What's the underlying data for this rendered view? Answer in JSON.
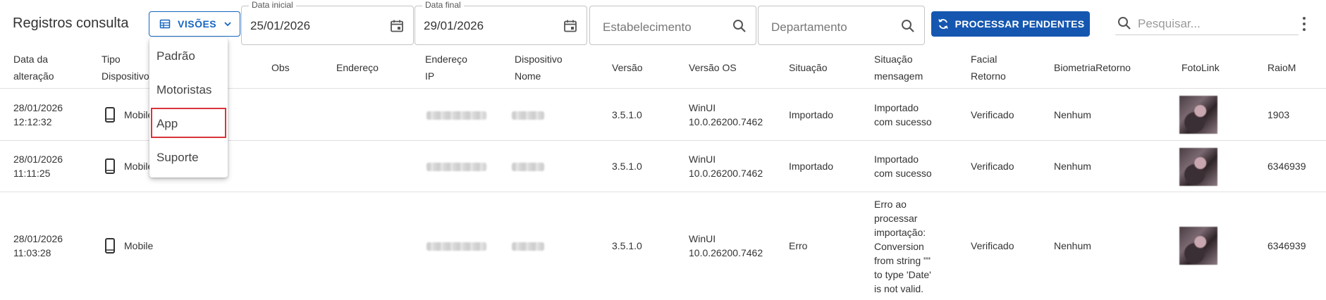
{
  "header": {
    "title": "Registros consulta",
    "views_button": "VISÕES",
    "start_date": {
      "label": "Data inicial",
      "value": "25/01/2026"
    },
    "end_date": {
      "label": "Data final",
      "value": "29/01/2026"
    },
    "establishment_placeholder": "Estabelecimento",
    "department_placeholder": "Departamento",
    "process_button": "PROCESSAR PENDENTES",
    "search_placeholder": "Pesquisar..."
  },
  "views_menu": {
    "items": [
      "Padrão",
      "Motoristas",
      "App",
      "Suporte"
    ],
    "highlighted": "App"
  },
  "columns": [
    {
      "key": "data",
      "lines": [
        "Data da",
        "alteração"
      ]
    },
    {
      "key": "tipo",
      "lines": [
        "Tipo",
        "Dispositivo"
      ]
    },
    {
      "key": "obs",
      "lines": [
        "Obs"
      ]
    },
    {
      "key": "endereco",
      "lines": [
        "Endereço"
      ]
    },
    {
      "key": "ip",
      "lines": [
        "Endereço",
        "IP"
      ]
    },
    {
      "key": "disp_nome",
      "lines": [
        "Dispositivo",
        "Nome"
      ]
    },
    {
      "key": "versao",
      "lines": [
        "Versão"
      ]
    },
    {
      "key": "versao_os",
      "lines": [
        "Versão OS"
      ]
    },
    {
      "key": "situacao",
      "lines": [
        "Situação"
      ]
    },
    {
      "key": "situacao_msg",
      "lines": [
        "Situação",
        "mensagem"
      ]
    },
    {
      "key": "facial",
      "lines": [
        "Facial",
        "Retorno"
      ]
    },
    {
      "key": "biometria",
      "lines": [
        "BiometriaRetorno"
      ]
    },
    {
      "key": "foto",
      "lines": [
        "FotoLink"
      ]
    },
    {
      "key": "raio",
      "lines": [
        "RaioM"
      ]
    }
  ],
  "rows": [
    {
      "data": [
        "28/01/2026",
        "12:12:32"
      ],
      "tipo": "Mobile",
      "versao": "3.5.1.0",
      "versao_os": [
        "WinUI",
        "10.0.26200.7462"
      ],
      "situacao": "Importado",
      "situacao_msg": [
        "Importado",
        "com sucesso"
      ],
      "facial": "Verificado",
      "biometria": "Nenhum",
      "raio": "1903"
    },
    {
      "data": [
        "28/01/2026",
        "11:11:25"
      ],
      "tipo": "Mobile",
      "versao": "3.5.1.0",
      "versao_os": [
        "WinUI",
        "10.0.26200.7462"
      ],
      "situacao": "Importado",
      "situacao_msg": [
        "Importado",
        "com sucesso"
      ],
      "facial": "Verificado",
      "biometria": "Nenhum",
      "raio": "6346939"
    },
    {
      "data": [
        "28/01/2026",
        "11:03:28"
      ],
      "tipo": "Mobile",
      "versao": "3.5.1.0",
      "versao_os": [
        "WinUI",
        "10.0.26200.7462"
      ],
      "situacao": "Erro",
      "situacao_msg": [
        "Erro ao",
        "processar",
        "importação:",
        "Conversion",
        "from string \"\"",
        "to type 'Date'",
        "is not valid."
      ],
      "facial": "Verificado",
      "biometria": "Nenhum",
      "raio": "6346939"
    }
  ],
  "icons": {
    "views": "table-view-icon",
    "calendar": "calendar-icon",
    "search": "search-icon",
    "process": "sync-icon",
    "menu": "more-vert-icon",
    "device": "smartphone-icon"
  },
  "colors": {
    "primary": "#1565c0",
    "primary_button": "#1557b0",
    "highlight_border": "#d9343b",
    "divider": "#e0e0e0"
  }
}
